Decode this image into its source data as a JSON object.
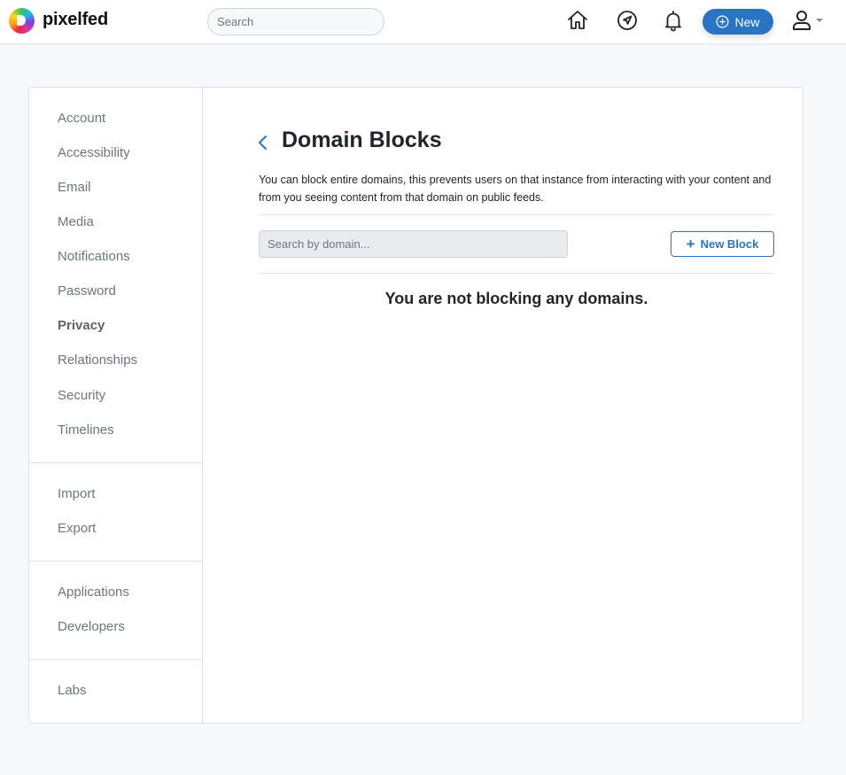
{
  "navbar": {
    "brand": "pixelfed",
    "search_placeholder": "Search",
    "icons": [
      "home-icon",
      "explore-icon",
      "notifications-bell-icon"
    ],
    "new_button_label": "New",
    "new_button_icon": "plus-circle-icon",
    "user_menu_icon": "user-icon",
    "accent_color": "#2b74c4"
  },
  "sidebar": {
    "groups": [
      {
        "items": [
          {
            "label": "Account",
            "active": false
          },
          {
            "label": "Accessibility",
            "active": false
          },
          {
            "label": "Email",
            "active": false
          },
          {
            "label": "Media",
            "active": false
          },
          {
            "label": "Notifications",
            "active": false
          },
          {
            "label": "Password",
            "active": false
          },
          {
            "label": "Privacy",
            "active": true
          },
          {
            "label": "Relationships",
            "active": false
          },
          {
            "label": "Security",
            "active": false
          },
          {
            "label": "Timelines",
            "active": false
          }
        ]
      },
      {
        "items": [
          {
            "label": "Import",
            "active": false
          },
          {
            "label": "Export",
            "active": false
          }
        ]
      },
      {
        "items": [
          {
            "label": "Applications",
            "active": false
          },
          {
            "label": "Developers",
            "active": false
          }
        ]
      },
      {
        "items": [
          {
            "label": "Labs",
            "active": false
          }
        ]
      }
    ]
  },
  "main": {
    "title": "Domain Blocks",
    "back_icon": "chevron-left-icon",
    "description": "You can block entire domains, this prevents users on that instance from interacting with your content and from you seeing content from that domain on public feeds.",
    "search_placeholder": "Search by domain...",
    "search_value": "",
    "new_block_label": "New Block",
    "empty_message": "You are not blocking any domains."
  }
}
